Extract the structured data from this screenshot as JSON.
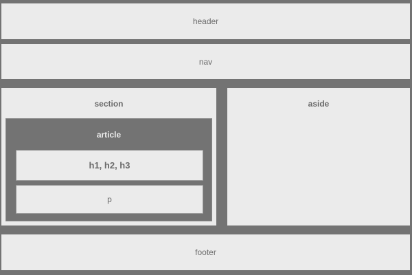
{
  "header": {
    "label": "header"
  },
  "nav": {
    "label": "nav"
  },
  "section": {
    "label": "section",
    "article": {
      "label": "article",
      "headings": "h1, h2, h3",
      "paragraph": "p"
    }
  },
  "aside": {
    "label": "aside"
  },
  "footer": {
    "label": "footer"
  },
  "colors": {
    "background": "#737373",
    "box": "#ebebeb",
    "text": "#6b6b6b"
  }
}
